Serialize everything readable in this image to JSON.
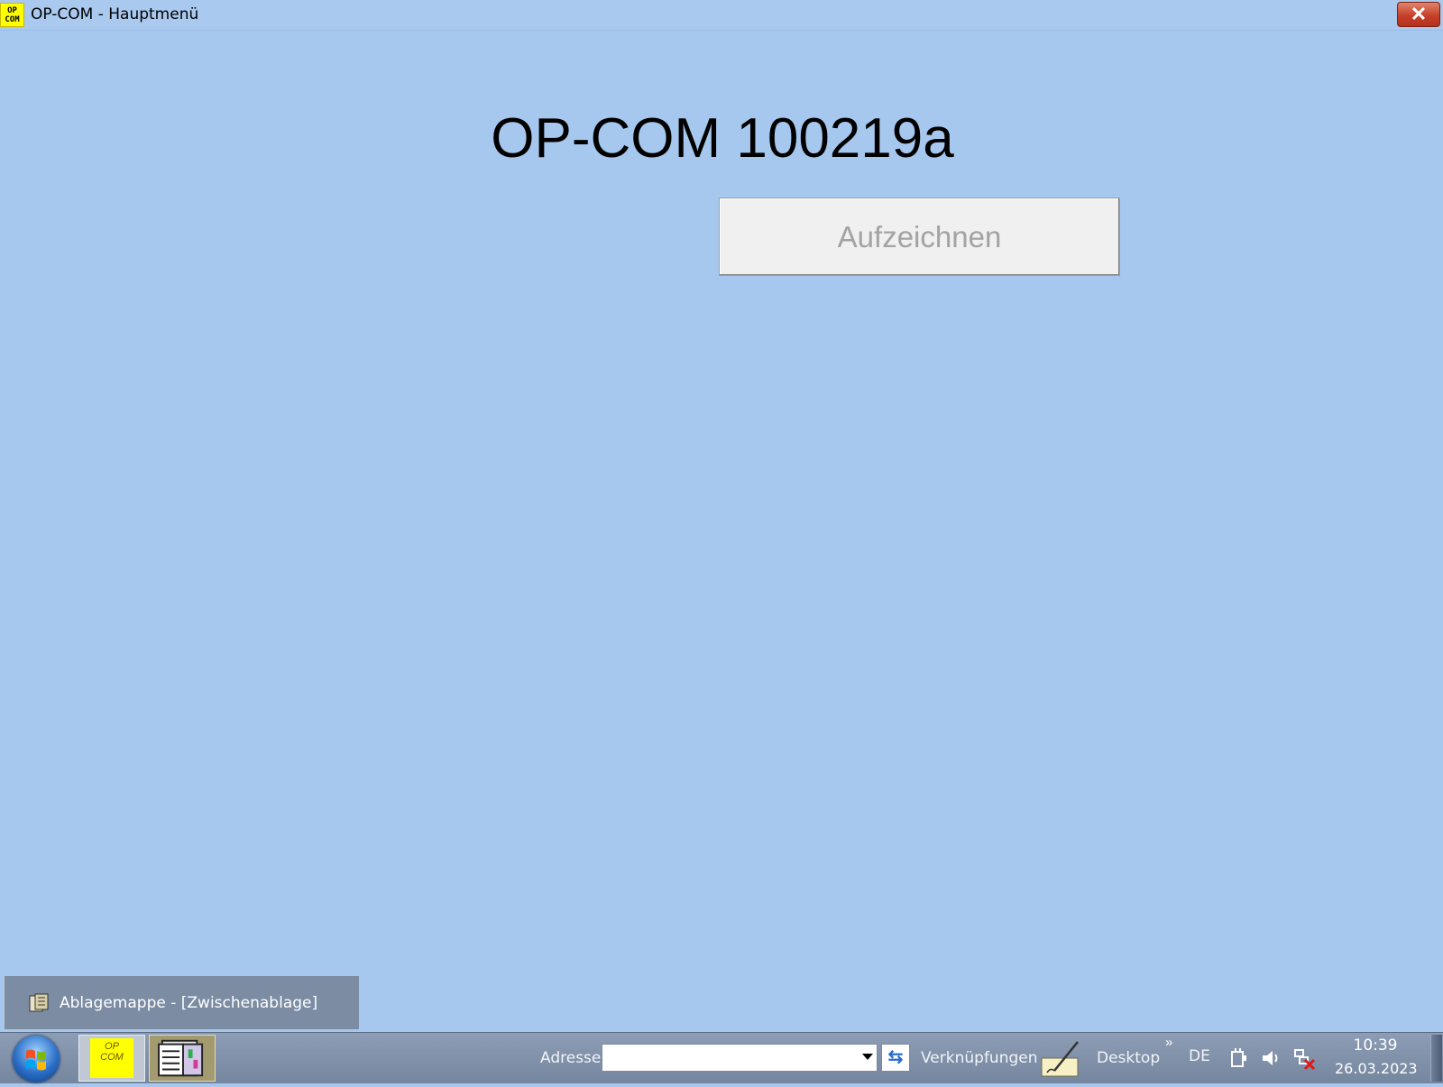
{
  "window": {
    "title": "OP-COM - Hauptmenü",
    "app_icon_text_top": "OP",
    "app_icon_text_bottom": "COM",
    "close_icon": "close-icon",
    "close_glyph": "✕"
  },
  "main": {
    "heading": "OP-COM 100219a",
    "record_button": "Aufzeichnen"
  },
  "clipboard_window": {
    "label": "Ablagemappe - [Zwischenablage]",
    "icon": "clipboard-book-icon"
  },
  "taskbar": {
    "start_icon": "windows-start-icon",
    "opcom_task_top": "OP",
    "opcom_task_bottom": "COM",
    "address_label": "Adresse",
    "address_value": "",
    "links_label": "Verknüpfungen",
    "desktop_label": "Desktop",
    "chevron": "»",
    "language": "DE",
    "time": "10:39",
    "date": "26.03.2023"
  },
  "colors": {
    "background": "#a7c8ee",
    "close_button": "#c7402a",
    "app_icon": "#ffff00",
    "taskbar": "#7f90a8"
  }
}
